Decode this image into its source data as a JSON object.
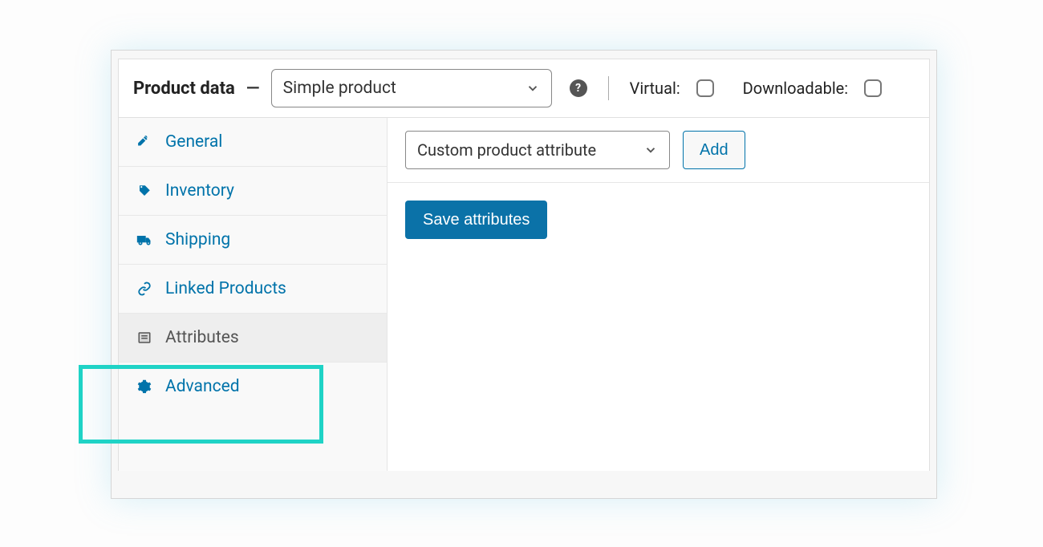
{
  "header": {
    "title": "Product data",
    "product_type": "Simple product",
    "virtual_label": "Virtual:",
    "downloadable_label": "Downloadable:"
  },
  "sidebar": {
    "tabs": [
      {
        "id": "general",
        "label": "General",
        "icon": "wrench-icon",
        "active": false
      },
      {
        "id": "inventory",
        "label": "Inventory",
        "icon": "tag-icon",
        "active": false
      },
      {
        "id": "shipping",
        "label": "Shipping",
        "icon": "truck-icon",
        "active": false
      },
      {
        "id": "linked",
        "label": "Linked Products",
        "icon": "link-icon",
        "active": false
      },
      {
        "id": "attributes",
        "label": "Attributes",
        "icon": "list-icon",
        "active": true
      },
      {
        "id": "advanced",
        "label": "Advanced",
        "icon": "gear-icon",
        "active": false
      }
    ]
  },
  "content": {
    "attribute_selector": "Custom product attribute",
    "add_label": "Add",
    "save_label": "Save attributes"
  }
}
